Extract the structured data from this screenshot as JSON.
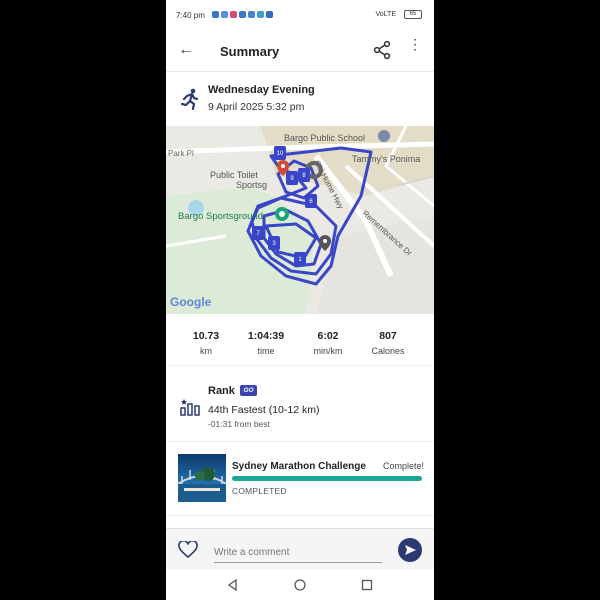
{
  "status_bar": {
    "time": "7:40 pm",
    "network": "VoLTE",
    "battery": "65"
  },
  "top_bar": {
    "title": "Summary"
  },
  "activity": {
    "name": "Wednesday Evening",
    "datetime": "9 April 2025 5:32 pm"
  },
  "map": {
    "labels": {
      "school": "Bargo Public School",
      "tammys": "Tammy's Ponima",
      "park_pl": "Park Pl",
      "toilet_line1": "Public Toilet",
      "toilet_line2": "Sportsg",
      "sportsground": "Bargo Sportsground",
      "old_hume": "Old Hume Hwy",
      "remembrance": "Remembrance Dr",
      "google": "Google"
    },
    "km_markers": [
      "10",
      "9",
      "8",
      "6",
      "7",
      "3",
      "1"
    ],
    "marker_unit": "km"
  },
  "stats": [
    {
      "value": "10.73",
      "label": "km"
    },
    {
      "value": "1:04:39",
      "label": "time"
    },
    {
      "value": "6:02",
      "label": "min/km"
    },
    {
      "value": "807",
      "label": "Calories"
    }
  ],
  "rank": {
    "heading": "Rank",
    "badge": "GO",
    "position": "44th Fastest (10-12 km)",
    "diff": "-01:31 from best"
  },
  "challenge": {
    "name": "Sydney Marathon Challenge",
    "status": "Complete!",
    "progress": 1.0,
    "state": "COMPLETED"
  },
  "comment": {
    "placeholder": "Write a comment"
  },
  "colors": {
    "route": "#3a46c8",
    "progress": "#1aa596",
    "send": "#2c3a73",
    "go_badge": "#3a45b0"
  },
  "icons": [
    "back-arrow-icon",
    "share-icon",
    "more-vert-icon",
    "run-icon",
    "rank-chart-icon",
    "heart-icon",
    "send-icon",
    "nav-back-icon",
    "nav-home-icon",
    "nav-recents-icon"
  ]
}
